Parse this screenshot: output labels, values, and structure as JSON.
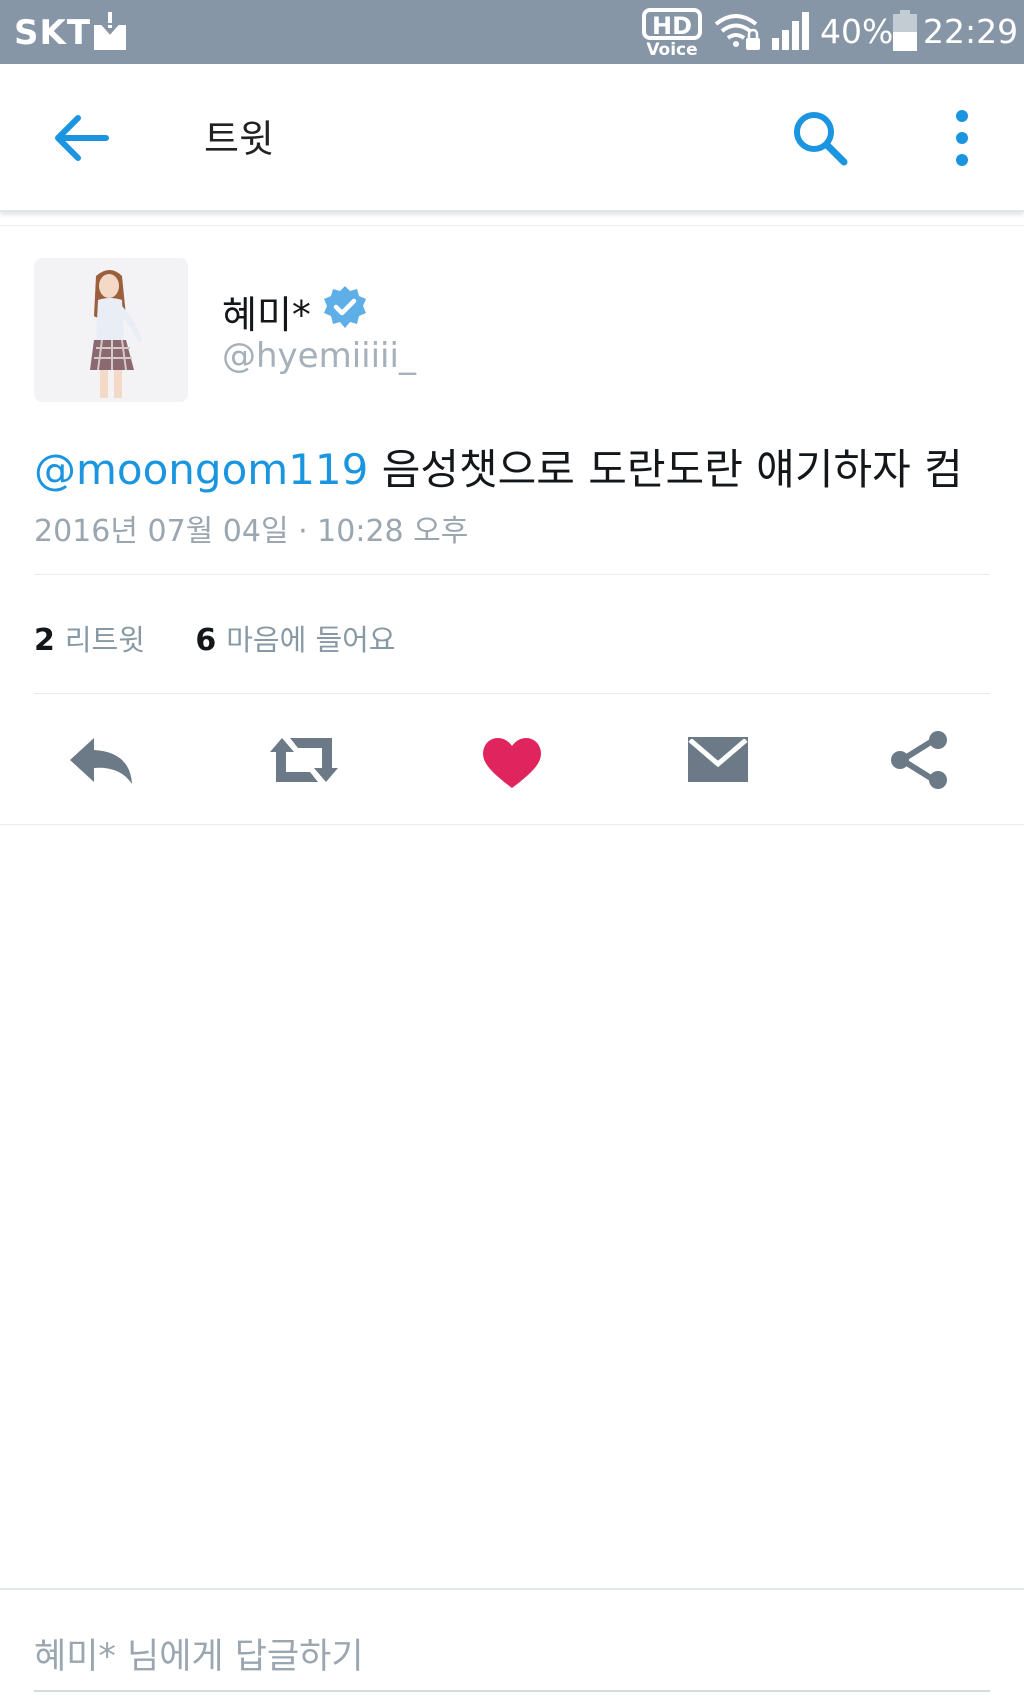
{
  "status_bar": {
    "carrier": "SKT",
    "hd_label": "HD",
    "voice_label": "Voice",
    "battery_percent": "40%",
    "time": "22:29",
    "icons": [
      "download-icon",
      "hd-voice-icon",
      "wifi-lock-icon",
      "signal-icon",
      "battery-icon"
    ]
  },
  "toolbar": {
    "title": "트윗",
    "icons": [
      "back-arrow-icon",
      "search-icon",
      "more-vertical-icon"
    ],
    "accent_color": "#1b95e0"
  },
  "tweet": {
    "display_name": "혜미*",
    "handle": "@hyemiiiii_",
    "verified": true,
    "mention": "@moongom119",
    "text": "음성챗으로 도란도란 얘기하자 컴",
    "timestamp": "2016년 07월 04일 · 10:28 오후",
    "retweet_count": "2",
    "retweet_label": "리트윗",
    "like_count": "6",
    "like_label": "마음에 들어요",
    "liked": true,
    "like_color": "#e0245e"
  },
  "actions": [
    "reply-icon",
    "retweet-icon",
    "heart-icon",
    "direct-message-icon",
    "share-icon"
  ],
  "reply": {
    "placeholder": "혜미* 님에게 답글하기"
  }
}
